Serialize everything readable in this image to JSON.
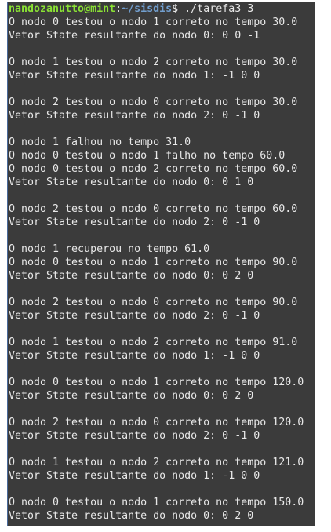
{
  "prompt": {
    "user_host": "nandozanutto@mint",
    "sep": ":",
    "path": "~/sisdis",
    "symbol": "$",
    "command": " ./tarefa3 3"
  },
  "output": [
    "O nodo 0 testou o nodo 1 correto no tempo 30.0",
    "Vetor State resultante do nodo 0: 0 0 -1",
    "",
    "O nodo 1 testou o nodo 2 correto no tempo 30.0",
    "Vetor State resultante do nodo 1: -1 0 0",
    "",
    "O nodo 2 testou o nodo 0 correto no tempo 30.0",
    "Vetor State resultante do nodo 2: 0 -1 0",
    "",
    "O nodo 1 falhou no tempo 31.0",
    "O nodo 0 testou o nodo 1 falho no tempo 60.0",
    "O nodo 0 testou o nodo 2 correto no tempo 60.0",
    "Vetor State resultante do nodo 0: 0 1 0",
    "",
    "O nodo 2 testou o nodo 0 correto no tempo 60.0",
    "Vetor State resultante do nodo 2: 0 -1 0",
    "",
    "O nodo 1 recuperou no tempo 61.0",
    "O nodo 0 testou o nodo 1 correto no tempo 90.0",
    "Vetor State resultante do nodo 0: 0 2 0",
    "",
    "O nodo 2 testou o nodo 0 correto no tempo 90.0",
    "Vetor State resultante do nodo 2: 0 -1 0",
    "",
    "O nodo 1 testou o nodo 2 correto no tempo 91.0",
    "Vetor State resultante do nodo 1: -1 0 0",
    "",
    "O nodo 0 testou o nodo 1 correto no tempo 120.0",
    "Vetor State resultante do nodo 0: 0 2 0",
    "",
    "O nodo 2 testou o nodo 0 correto no tempo 120.0",
    "Vetor State resultante do nodo 2: 0 -1 0",
    "",
    "O nodo 1 testou o nodo 2 correto no tempo 121.0",
    "Vetor State resultante do nodo 1: -1 0 0",
    "",
    "O nodo 0 testou o nodo 1 correto no tempo 150.0",
    "Vetor State resultante do nodo 0: 0 2 0"
  ]
}
